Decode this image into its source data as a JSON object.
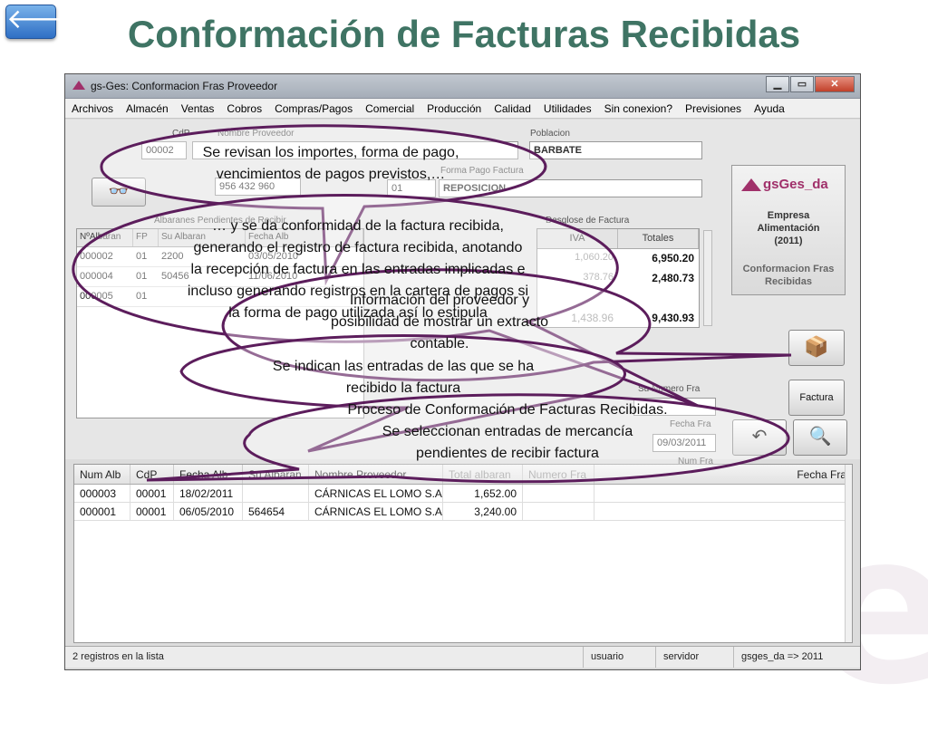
{
  "slide": {
    "title": "Conformación de Facturas Recibidas",
    "back_label": "🡐"
  },
  "window": {
    "title": "gs-Ges: Conformacion Fras Proveedor",
    "controls": [
      "▁",
      "▭",
      "✕"
    ]
  },
  "menu": [
    "Archivos",
    "Almacén",
    "Ventas",
    "Cobros",
    "Compras/Pagos",
    "Comercial",
    "Producción",
    "Calidad",
    "Utilidades",
    "Sin conexion?",
    "Previsiones",
    "Ayuda"
  ],
  "form": {
    "cdp_label": "CdP",
    "cdp_value": "00002",
    "nombre_label": "Nombre Proveedor",
    "poblacion_label": "Poblacion",
    "poblacion_value": "BARBATE",
    "telefono_value": "956 432 960",
    "forma_pago_label": "Forma Pago Factura",
    "forma_pago_code": "01",
    "forma_pago_value": "REPOSICION",
    "albaranes_label": "Albaranes Pendientes de Recibir",
    "desglose_label": "Desglose de Factura",
    "su_numero_label": "Su Numero Fra",
    "fecha_fra_label": "Fecha Fra",
    "fecha_fra_value": "09/03/2011",
    "num_fra_label": "Num Fra"
  },
  "grid_albaranes": {
    "columns": [
      "NºAlbaran",
      "FP",
      "Su Albaran",
      "Fecha Alb"
    ],
    "rows": [
      {
        "num": "000002",
        "fp": "01",
        "su": "2200",
        "fecha": "03/05/2010"
      },
      {
        "num": "000004",
        "fp": "01",
        "su": "50456",
        "fecha": "11/06/2010"
      },
      {
        "num": "000005",
        "fp": "01",
        "su": "",
        "fecha": ""
      }
    ]
  },
  "desglose": {
    "columns": [
      "IVA",
      "Totales"
    ],
    "rows": [
      {
        "iva": "1,060.20",
        "total": "6,950.20"
      },
      {
        "iva": "378.76",
        "total": "2,480.73"
      },
      {
        "iva": "",
        "total": ""
      },
      {
        "iva": "1,438.96",
        "total": "9,430.93"
      }
    ]
  },
  "buttons": {
    "factura": "Factura"
  },
  "grid_pendientes": {
    "columns": [
      "Num Alb",
      "CdP",
      "Fecha Alb",
      "Su Albaran",
      "Nombre Proveedor",
      "Total albaran",
      "Numero Fra",
      "Fecha Fra"
    ],
    "rows": [
      {
        "num": "000003",
        "cdp": "00001",
        "fecha": "18/02/2011",
        "su": "",
        "nombre": "CÁRNICAS EL LOMO S.A.",
        "total": "1,652.00",
        "numfra": "",
        "fechafra": ""
      },
      {
        "num": "000001",
        "cdp": "00001",
        "fecha": "06/05/2010",
        "su": "564654",
        "nombre": "CÁRNICAS EL LOMO S.A.",
        "total": "3,240.00",
        "numfra": "",
        "fechafra": ""
      }
    ]
  },
  "status": {
    "records": "2 registros en la lista",
    "user": "usuario",
    "server": "servidor",
    "db": "gsges_da => 2011"
  },
  "logo": {
    "brand": "gsGes_da",
    "company_line1": "Empresa",
    "company_line2": "Alimentación",
    "company_line3": "(2011)",
    "module_line1": "Conformacion Fras",
    "module_line2": "Recibidas"
  },
  "callouts": {
    "c1_line1": "Se revisan los importes, forma de pago,",
    "c1_line2": "vencimientos de pagos previstos,…",
    "c2_line1": "… y se da conformidad de la factura recibida,",
    "c2_line2": "generando el registro de factura recibida, anotando",
    "c2_line3": "la recepción de factura en las entradas implicadas e",
    "c2_line4": "incluso generando registros en la cartera de pagos si",
    "c2_line5": "la forma de pago utilizada así lo estipula",
    "c3_line1": "Información del proveedor y",
    "c3_line2": "posibilidad de mostrar un extracto",
    "c3_line3": "contable.",
    "c4_line1": "Se indican las entradas de las que se ha",
    "c4_line2": "recibido la factura",
    "c5_line1": "Proceso de Conformación de Facturas Recibidas.",
    "c5_line2": "Se seleccionan entradas de mercancía",
    "c5_line3": "pendientes de recibir factura"
  },
  "colors": {
    "title": "#3f7464",
    "callout_border": "#5c1d5c",
    "brand": "#a0306a"
  }
}
